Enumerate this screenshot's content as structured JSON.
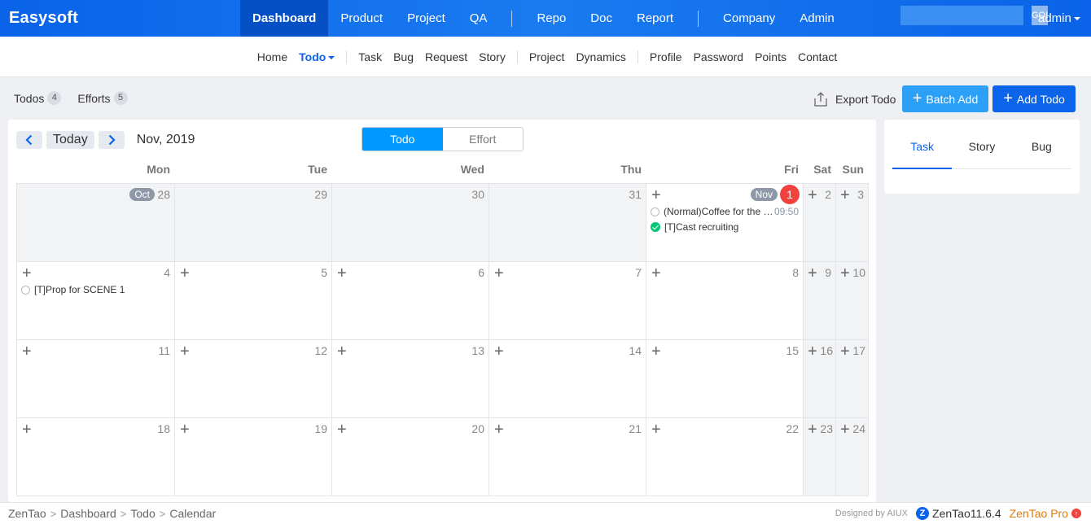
{
  "header": {
    "brand": "Easysoft",
    "nav": [
      {
        "label": "Dashboard",
        "active": true
      },
      {
        "label": "Product"
      },
      {
        "label": "Project"
      },
      {
        "label": "QA"
      },
      {
        "label": "Repo"
      },
      {
        "label": "Doc"
      },
      {
        "label": "Report"
      },
      {
        "label": "Company"
      },
      {
        "label": "Admin"
      }
    ],
    "search_button": "GO!",
    "user": "admin"
  },
  "subnav": {
    "items": [
      "Home",
      "Todo",
      "Task",
      "Bug",
      "Request",
      "Story",
      "Project",
      "Dynamics",
      "Profile",
      "Password",
      "Points",
      "Contact"
    ],
    "active": "Todo"
  },
  "toolbar": {
    "todos_label": "Todos",
    "todos_count": "4",
    "efforts_label": "Efforts",
    "efforts_count": "5",
    "export_label": "Export Todo",
    "batch_add_label": "Batch Add",
    "add_todo_label": "Add Todo"
  },
  "calendar": {
    "today_label": "Today",
    "month_title": "Nov, 2019",
    "view_todo": "Todo",
    "view_effort": "Effort",
    "weekdays": [
      "Mon",
      "Tue",
      "Wed",
      "Thu",
      "Fri",
      "Sat",
      "Sun"
    ],
    "weeks": [
      [
        "28",
        "29",
        "30",
        "31",
        "1",
        "2",
        "3"
      ],
      [
        "4",
        "5",
        "6",
        "7",
        "8",
        "9",
        "10"
      ],
      [
        "11",
        "12",
        "13",
        "14",
        "15",
        "16",
        "17"
      ],
      [
        "18",
        "19",
        "20",
        "21",
        "22",
        "23",
        "24"
      ]
    ],
    "badge_oct": "Oct",
    "badge_nov": "Nov",
    "events": {
      "coffee_text": "(Normal)Coffee for the li...",
      "coffee_time": "09:50",
      "cast_text": "[T]Cast recruiting",
      "prop_text": "[T]Prop for SCENE 1"
    }
  },
  "side": {
    "tabs": [
      "Task",
      "Story",
      "Bug"
    ]
  },
  "footer": {
    "crumbs": [
      "ZenTao",
      "Dashboard",
      "Todo",
      "Calendar"
    ],
    "designed_by": "Designed by AIUX",
    "version": "ZenTao11.6.4",
    "pro": "ZenTao Pro"
  }
}
